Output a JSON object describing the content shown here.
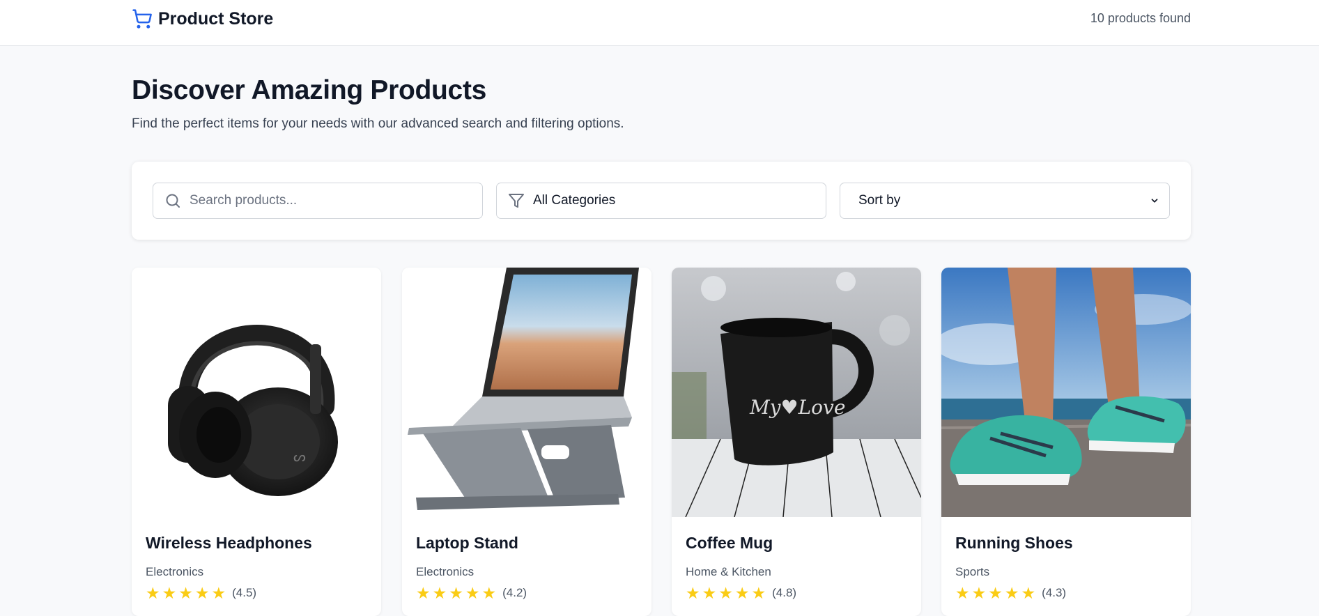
{
  "header": {
    "logo_text": "Product Store",
    "results_count": "10 products found",
    "accent_color": "#2563eb"
  },
  "hero": {
    "title": "Discover Amazing Products",
    "subtitle": "Find the perfect items for your needs with our advanced search and filtering options."
  },
  "filters": {
    "search_placeholder": "Search products...",
    "search_value": "",
    "category_value": "All Categories",
    "sort_value": "Sort by"
  },
  "products": [
    {
      "name": "Wireless Headphones",
      "category": "Electronics",
      "rating": 4.5,
      "rating_text": "(4.5)"
    },
    {
      "name": "Laptop Stand",
      "category": "Electronics",
      "rating": 4.2,
      "rating_text": "(4.2)"
    },
    {
      "name": "Coffee Mug",
      "category": "Home & Kitchen",
      "rating": 4.8,
      "rating_text": "(4.8)"
    },
    {
      "name": "Running Shoes",
      "category": "Sports",
      "rating": 4.3,
      "rating_text": "(4.3)"
    }
  ],
  "icons": {
    "logo": "shopping-cart-icon",
    "search": "search-icon",
    "category": "filter-icon",
    "sort": "chevron-down-icon",
    "rating": "star-icon"
  },
  "colors": {
    "star": "#facc15",
    "page_background": "#f8f9fb"
  }
}
